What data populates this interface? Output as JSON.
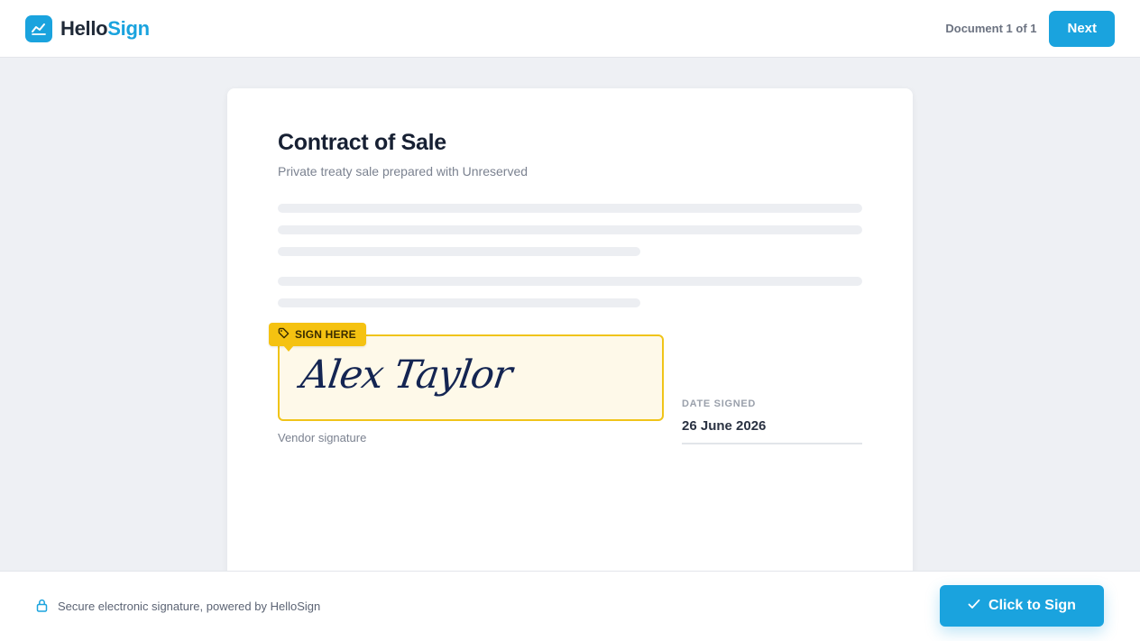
{
  "header": {
    "brand_part1": "Hello",
    "brand_part2": "Sign",
    "document_count": "Document 1 of 1",
    "next_label": "Next"
  },
  "document": {
    "title": "Contract of Sale",
    "subtitle": "Private treaty sale prepared with Unreserved",
    "sign_tag_label": "SIGN HERE",
    "signature_text": "Alex Taylor",
    "signature_caption": "Vendor signature",
    "date_label": "DATE SIGNED",
    "date_value": "26 June 2026"
  },
  "footer": {
    "security_text": "Secure electronic signature, powered by HelloSign",
    "sign_button_label": "Click to Sign"
  },
  "icons": {
    "brand": "chart-line-icon",
    "tag": "tag-icon",
    "lock": "lock-icon",
    "check": "check-icon"
  },
  "colors": {
    "accent": "#1aa3de",
    "sign_tag": "#f5c211",
    "signature_box_border": "#f0c419",
    "signature_ink": "#142552"
  }
}
